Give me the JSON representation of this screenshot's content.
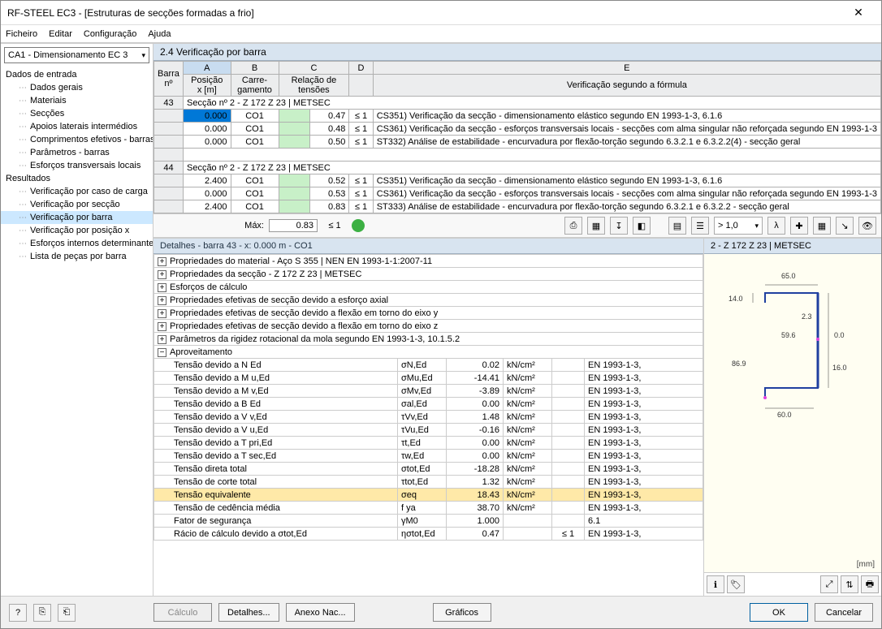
{
  "window": {
    "title": "RF-STEEL EC3 - [Estruturas de secções formadas a frio]"
  },
  "menu": {
    "file": "Ficheiro",
    "edit": "Editar",
    "config": "Configuração",
    "help": "Ajuda"
  },
  "combo": {
    "value": "CA1 - Dimensionamento EC 3"
  },
  "tree": {
    "g1": "Dados de entrada",
    "i1": "Dados gerais",
    "i2": "Materiais",
    "i3": "Secções",
    "i4": "Apoios laterais intermédios",
    "i5": "Comprimentos efetivos - barras",
    "i6": "Parâmetros - barras",
    "i7": "Esforços transversais locais",
    "g2": "Resultados",
    "r1": "Verificação por caso de carga",
    "r2": "Verificação por secção",
    "r3": "Verificação por barra",
    "r4": "Verificação por posição x",
    "r5": "Esforços internos determinantes",
    "r6": "Lista de peças por barra"
  },
  "panel": {
    "title": "2.4 Verificação por barra"
  },
  "cols": {
    "A": "A",
    "B": "B",
    "C": "C",
    "D": "D",
    "E": "E",
    "barra": "Barra\nnº",
    "pos": "Posição\nx [m]",
    "carr": "Carre-\ngamento",
    "rel": "Relação de\ntensões",
    "ver": "Verificação segundo a fórmula"
  },
  "sections": {
    "s43": {
      "num": "43",
      "title": "Secção nº 2 - Z 172 Z 23 | METSEC",
      "rows": [
        {
          "pos": "0.000",
          "co": "CO1",
          "ratio": "0.47",
          "le": "≤ 1",
          "desc": "CS351) Verificação da secção - dimensionamento elástico segundo EN 1993-1-3, 6.1.6"
        },
        {
          "pos": "0.000",
          "co": "CO1",
          "ratio": "0.48",
          "le": "≤ 1",
          "desc": "CS361) Verificação da secção - esforços transversais locais - secções com alma singular não reforçada segundo EN 1993-1-3"
        },
        {
          "pos": "0.000",
          "co": "CO1",
          "ratio": "0.50",
          "le": "≤ 1",
          "desc": "ST332) Análise de estabilidade - encurvadura por flexão-torção segundo 6.3.2.1 e 6.3.2.2(4) - secção geral"
        }
      ]
    },
    "s44": {
      "num": "44",
      "title": "Secção nº 2 - Z 172 Z 23 | METSEC",
      "rows": [
        {
          "pos": "2.400",
          "co": "CO1",
          "ratio": "0.52",
          "le": "≤ 1",
          "desc": "CS351) Verificação da secção - dimensionamento elástico segundo EN 1993-1-3, 6.1.6"
        },
        {
          "pos": "0.000",
          "co": "CO1",
          "ratio": "0.53",
          "le": "≤ 1",
          "desc": "CS361) Verificação da secção - esforços transversais locais - secções com alma singular não reforçada segundo EN 1993-1-3"
        },
        {
          "pos": "2.400",
          "co": "CO1",
          "ratio": "0.83",
          "le": "≤ 1",
          "desc": "ST333) Análise de estabilidade - encurvadura por flexão-torção segundo 6.3.2.1 e 6.3.2.2 - secção geral"
        }
      ]
    }
  },
  "max": {
    "label": "Máx:",
    "value": "0.83",
    "le": "≤ 1",
    "dd": "> 1,0"
  },
  "details": {
    "title": "Detalhes - barra 43 - x: 0.000 m - CO1",
    "groups": [
      "Propriedades do material - Aço S 355 | NEN EN 1993-1-1:2007-11",
      "Propriedades da secção  - Z 172 Z 23 | METSEC",
      "Esforços de cálculo",
      "Propriedades efetivas de secção devido a esforço axial",
      "Propriedades efetivas de secção devido a flexão em torno do eixo y",
      "Propriedades efetivas de secção devido a flexão em torno do eixo z",
      "Parâmetros da rigidez rotacional da mola segundo EN 1993-1-3, 10.1.5.2"
    ],
    "aprov": "Aproveitamento",
    "rows": [
      {
        "name": "Tensão devido a N Ed",
        "sym": "σN,Ed",
        "val": "0.02",
        "unit": "kN/cm²",
        "ref": "EN 1993-1-3,"
      },
      {
        "name": "Tensão devido a M u,Ed",
        "sym": "σMu,Ed",
        "val": "-14.41",
        "unit": "kN/cm²",
        "ref": "EN 1993-1-3,"
      },
      {
        "name": "Tensão devido a M v,Ed",
        "sym": "σMv,Ed",
        "val": "-3.89",
        "unit": "kN/cm²",
        "ref": "EN 1993-1-3,"
      },
      {
        "name": "Tensão devido a B Ed",
        "sym": "σal,Ed",
        "val": "0.00",
        "unit": "kN/cm²",
        "ref": "EN 1993-1-3,"
      },
      {
        "name": "Tensão devido a V v,Ed",
        "sym": "τVv,Ed",
        "val": "1.48",
        "unit": "kN/cm²",
        "ref": "EN 1993-1-3,"
      },
      {
        "name": "Tensão devido a V u,Ed",
        "sym": "τVu,Ed",
        "val": "-0.16",
        "unit": "kN/cm²",
        "ref": "EN 1993-1-3,"
      },
      {
        "name": "Tensão devido a T pri,Ed",
        "sym": "τt,Ed",
        "val": "0.00",
        "unit": "kN/cm²",
        "ref": "EN 1993-1-3,"
      },
      {
        "name": "Tensão devido a T sec,Ed",
        "sym": "τw,Ed",
        "val": "0.00",
        "unit": "kN/cm²",
        "ref": "EN 1993-1-3,"
      },
      {
        "name": "Tensão direta total",
        "sym": "σtot,Ed",
        "val": "-18.28",
        "unit": "kN/cm²",
        "ref": "EN 1993-1-3,"
      },
      {
        "name": "Tensão de corte total",
        "sym": "τtot,Ed",
        "val": "1.32",
        "unit": "kN/cm²",
        "ref": "EN 1993-1-3,"
      },
      {
        "name": "Tensão equivalente",
        "sym": "σeq",
        "val": "18.43",
        "unit": "kN/cm²",
        "ref": "EN 1993-1-3,",
        "sel": true
      },
      {
        "name": "Tensão de cedência média",
        "sym": "f ya",
        "val": "38.70",
        "unit": "kN/cm²",
        "ref": "EN 1993-1-3,"
      },
      {
        "name": "Fator de segurança",
        "sym": "γM0",
        "val": "1.000",
        "unit": "",
        "ref": "6.1"
      },
      {
        "name": "Rácio de cálculo devido a σtot,Ed",
        "sym": "ησtot,Ed",
        "val": "0.47",
        "unit": "",
        "chk": "≤ 1",
        "ref": "EN 1993-1-3,"
      }
    ]
  },
  "preview": {
    "title": "2 - Z 172 Z 23 | METSEC",
    "mm": "[mm]",
    "dims": {
      "d1": "65.0",
      "d2": "14.0",
      "d3": "2.3",
      "d4": "59.6",
      "d5": "0.0",
      "d6": "86.9",
      "d7": "16.0",
      "d8": "60.0"
    }
  },
  "footer": {
    "calc": "Cálculo",
    "det": "Detalhes...",
    "anex": "Anexo Nac...",
    "graf": "Gráficos",
    "ok": "OK",
    "cancel": "Cancelar"
  }
}
